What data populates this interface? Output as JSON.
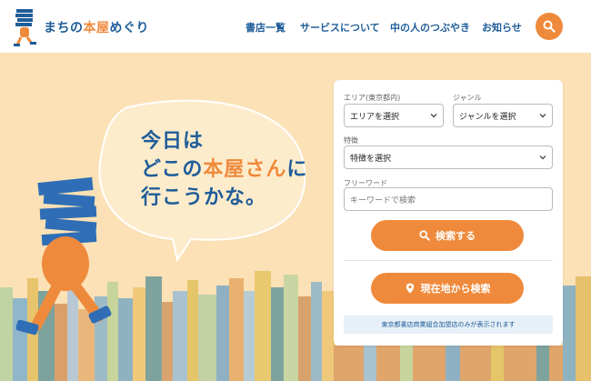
{
  "site": {
    "logo_main": "まちの",
    "logo_accent": "本屋",
    "logo_tail": "めぐり"
  },
  "nav": {
    "items": [
      {
        "label": "書店一覧"
      },
      {
        "label": "サービスについて"
      },
      {
        "label": "中の人のつぶやき"
      },
      {
        "label": "お知らせ"
      }
    ],
    "search_icon": "search-icon"
  },
  "hero": {
    "line1": "今日は",
    "line2_a": "どこの",
    "line2_accent": "本屋さん",
    "line2_b": "に",
    "line3": "行こうかな。"
  },
  "search": {
    "area_label": "エリア(東京都内)",
    "area_value": "エリアを選択",
    "genre_label": "ジャンル",
    "genre_value": "ジャンルを選択",
    "feature_label": "特徴",
    "feature_value": "特徴を選択",
    "keyword_label": "フリーワード",
    "keyword_placeholder": "キーワードで検索",
    "search_button": "検索する",
    "location_button": "現在地から検索",
    "note": "東京都書店商業組合加盟店のみが表示されます"
  },
  "colors": {
    "accent": "#ef8a3c",
    "brand": "#1f5d99",
    "hero_bg": "#fbe1b5"
  }
}
